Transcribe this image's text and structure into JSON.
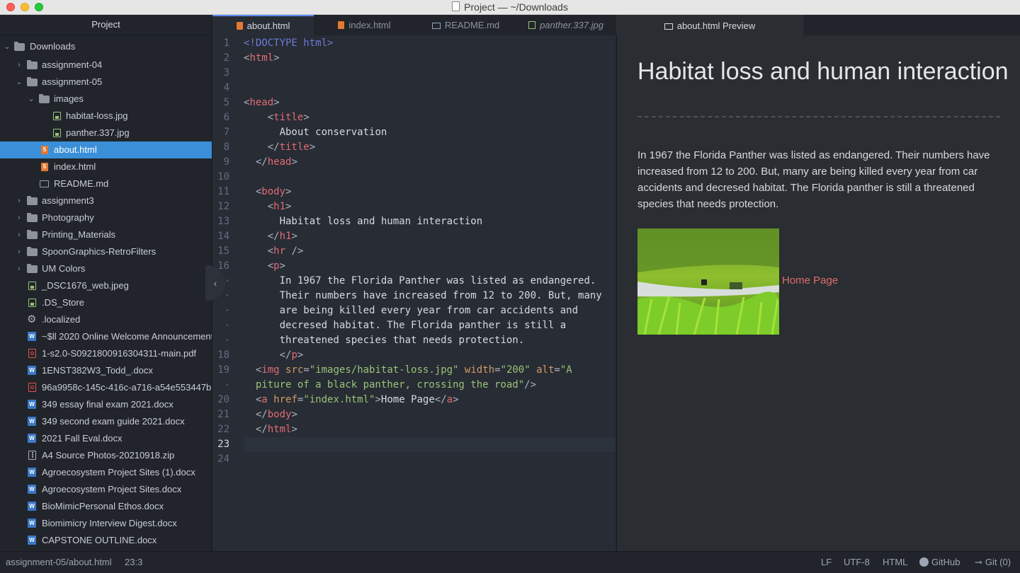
{
  "window": {
    "title": "Project — ~/Downloads"
  },
  "sidebar": {
    "header": "Project",
    "items": [
      {
        "label": "Downloads"
      },
      {
        "label": "assignment-04"
      },
      {
        "label": "assignment-05"
      },
      {
        "label": "images"
      },
      {
        "label": "habitat-loss.jpg"
      },
      {
        "label": "panther.337.jpg"
      },
      {
        "label": "about.html"
      },
      {
        "label": "index.html"
      },
      {
        "label": "README.md"
      },
      {
        "label": "assignment3"
      },
      {
        "label": "Photography"
      },
      {
        "label": "Printing_Materials"
      },
      {
        "label": "SpoonGraphics-RetroFilters"
      },
      {
        "label": "UM Colors"
      },
      {
        "label": "_DSC1676_web.jpeg"
      },
      {
        "label": ".DS_Store"
      },
      {
        "label": ".localized"
      },
      {
        "label": "~$ll 2020 Online Welcome Announcement"
      },
      {
        "label": "1-s2.0-S0921800916304311-main.pdf"
      },
      {
        "label": "1ENST382W3_Todd_.docx"
      },
      {
        "label": "96a9958c-145c-416c-a716-a54e553447b"
      },
      {
        "label": "349 essay final exam 2021.docx"
      },
      {
        "label": "349 second exam guide 2021.docx"
      },
      {
        "label": "2021 Fall Eval.docx"
      },
      {
        "label": "A4 Source Photos-20210918.zip"
      },
      {
        "label": "Agroecosystem Project Sites (1).docx"
      },
      {
        "label": "Agroecosystem Project Sites.docx"
      },
      {
        "label": "BioMimicPersonal Ethos.docx"
      },
      {
        "label": "Biomimicry Interview Digest.docx"
      },
      {
        "label": "CAPSTONE OUTLINE.docx"
      }
    ]
  },
  "tabs": [
    {
      "label": "about.html"
    },
    {
      "label": "index.html"
    },
    {
      "label": "README.md"
    },
    {
      "label": "panther.337.jpg"
    },
    {
      "label": "about.html Preview"
    }
  ],
  "editor": {
    "line_numbers": [
      "1",
      "2",
      "3",
      "4",
      "5",
      "6",
      "7",
      "8",
      "9",
      "10",
      "11",
      "12",
      "13",
      "14",
      "15",
      "16",
      "17",
      "18",
      "19",
      "20",
      "21",
      "22",
      "23",
      "24"
    ],
    "wrap_marker": "•",
    "code": {
      "l1a": "<!DOCTYPE",
      "l1b": " html",
      "l1c": ">",
      "l2": "html",
      "l5": "head",
      "l6": "title",
      "l7": "About conservation",
      "l8": "title",
      "l9": "head",
      "l11": "body",
      "l12": "h1",
      "l13": "Habitat loss and human interaction",
      "l14": "h1",
      "l15": "hr",
      "l16": "p",
      "p1": "In 1967 the Florida Panther was listed as endangered.",
      "p2": "Their numbers have increased from 12 to 200. But, many",
      "p3": "are being killed every year from car accidents and",
      "p4": "decresed habitat. The Florida panther is still a",
      "p5": "threatened species that needs protection.",
      "l18": "p",
      "img_tag": "img",
      "src_attr": "src",
      "src_val": "\"images/habitat-loss.jpg\"",
      "width_attr": "width",
      "width_val": "\"200\"",
      "alt_attr": "alt",
      "alt_val1": "\"A",
      "alt_val2": "piture of a black panther, crossing the road\"",
      "a_tag": "a",
      "href_attr": "href",
      "href_val": "\"index.html\"",
      "a_text": "Home Page",
      "l21": "body",
      "l22": "html"
    }
  },
  "preview": {
    "h1": "Habitat loss and human interaction",
    "paragraph": "In 1967 the Florida Panther was listed as endangered. Their numbers have increased from 12 to 200. But, many are being killed every year from car accidents and decresed habitat. The Florida panther is still a threatened species that needs protection.",
    "link": "Home Page"
  },
  "statusbar": {
    "path": "assignment-05/about.html",
    "cursor": "23:3",
    "line_ending": "LF",
    "encoding": "UTF-8",
    "grammar": "HTML",
    "github": "GitHub",
    "git": "Git (0)"
  },
  "colors": {
    "accent": "#568af2",
    "selection": "#3b8fd8",
    "link": "#e06c6c"
  },
  "icons": {
    "folder": "folder-icon",
    "html": "html5-icon",
    "image": "image-file-icon",
    "markdown": "markdown-icon",
    "word": "word-doc-icon",
    "pdf": "pdf-icon",
    "zip": "zip-icon",
    "settings": "gear-icon",
    "github": "github-icon",
    "git": "git-commit-icon"
  }
}
